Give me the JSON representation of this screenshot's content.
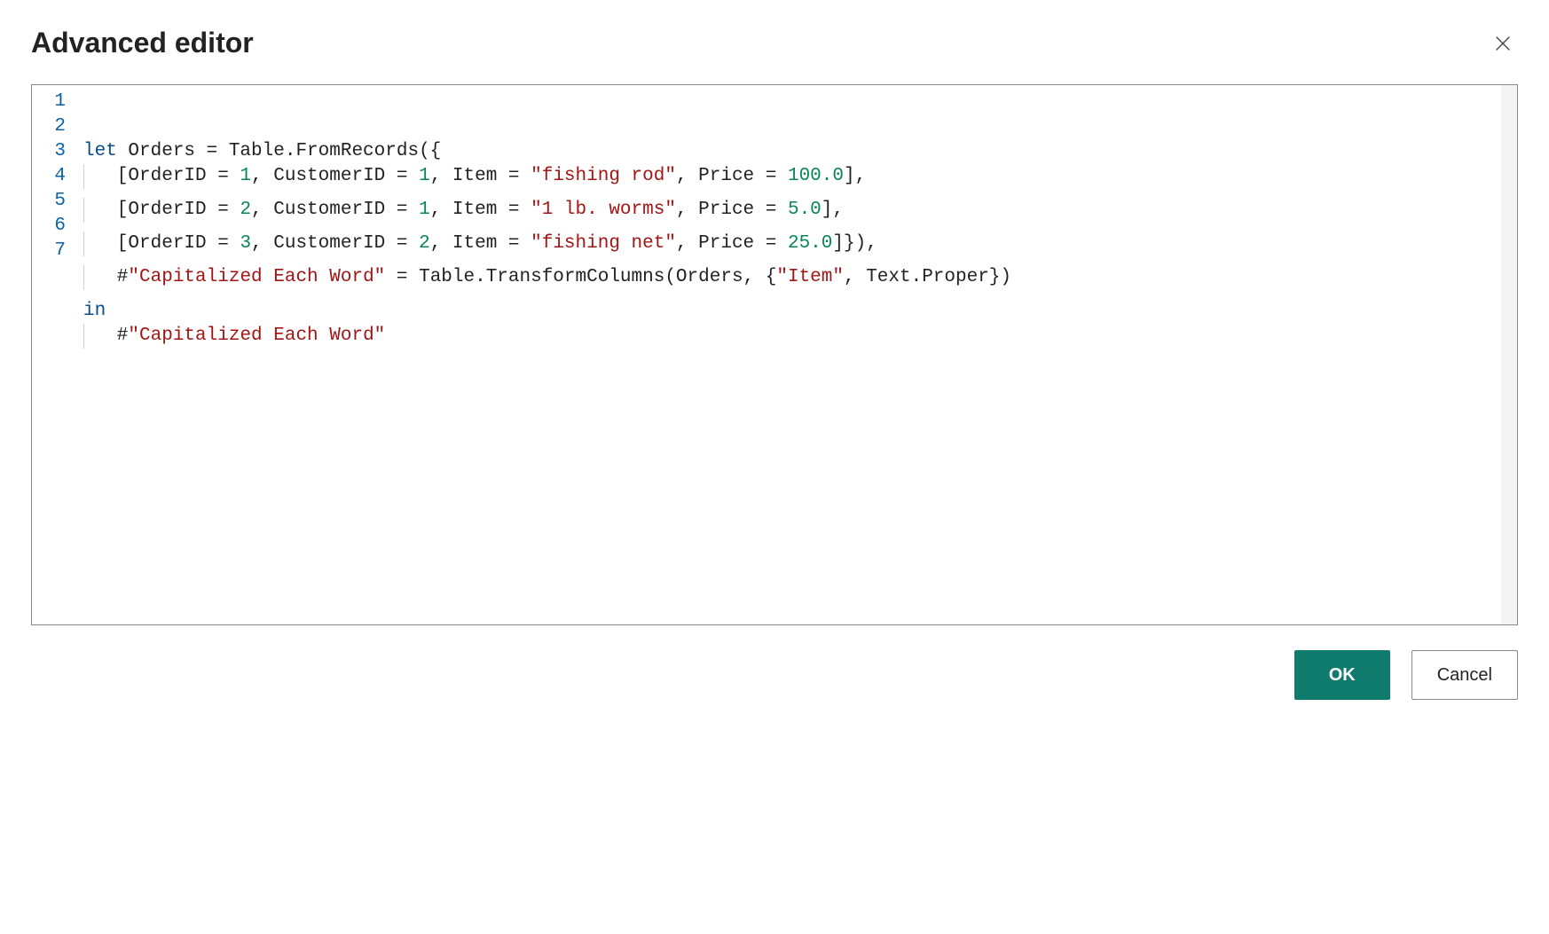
{
  "header": {
    "title": "Advanced editor"
  },
  "editor": {
    "line_numbers": [
      "1",
      "2",
      "3",
      "4",
      "5",
      "6",
      "7"
    ],
    "lines": [
      {
        "indent": 0,
        "tokens": [
          {
            "t": "kw",
            "v": "let"
          },
          {
            "t": "ident",
            "v": " Orders = Table.FromRecords({"
          }
        ]
      },
      {
        "indent": 1,
        "tokens": [
          {
            "t": "ident",
            "v": "   [OrderID = "
          },
          {
            "t": "num",
            "v": "1"
          },
          {
            "t": "ident",
            "v": ", CustomerID = "
          },
          {
            "t": "num",
            "v": "1"
          },
          {
            "t": "ident",
            "v": ", Item = "
          },
          {
            "t": "str",
            "v": "\"fishing rod\""
          },
          {
            "t": "ident",
            "v": ", Price = "
          },
          {
            "t": "num",
            "v": "100.0"
          },
          {
            "t": "ident",
            "v": "],"
          }
        ]
      },
      {
        "indent": 1,
        "tokens": [
          {
            "t": "ident",
            "v": "   [OrderID = "
          },
          {
            "t": "num",
            "v": "2"
          },
          {
            "t": "ident",
            "v": ", CustomerID = "
          },
          {
            "t": "num",
            "v": "1"
          },
          {
            "t": "ident",
            "v": ", Item = "
          },
          {
            "t": "str",
            "v": "\"1 lb. worms\""
          },
          {
            "t": "ident",
            "v": ", Price = "
          },
          {
            "t": "num",
            "v": "5.0"
          },
          {
            "t": "ident",
            "v": "],"
          }
        ]
      },
      {
        "indent": 1,
        "tokens": [
          {
            "t": "ident",
            "v": "   [OrderID = "
          },
          {
            "t": "num",
            "v": "3"
          },
          {
            "t": "ident",
            "v": ", CustomerID = "
          },
          {
            "t": "num",
            "v": "2"
          },
          {
            "t": "ident",
            "v": ", Item = "
          },
          {
            "t": "str",
            "v": "\"fishing net\""
          },
          {
            "t": "ident",
            "v": ", Price = "
          },
          {
            "t": "num",
            "v": "25.0"
          },
          {
            "t": "ident",
            "v": "]}),"
          }
        ]
      },
      {
        "indent": 1,
        "tokens": [
          {
            "t": "ident",
            "v": "   #"
          },
          {
            "t": "str",
            "v": "\"Capitalized Each Word\""
          },
          {
            "t": "ident",
            "v": " = Table.TransformColumns(Orders, {"
          },
          {
            "t": "str",
            "v": "\"Item\""
          },
          {
            "t": "ident",
            "v": ", Text.Proper})"
          }
        ]
      },
      {
        "indent": 0,
        "tokens": [
          {
            "t": "kw",
            "v": "in"
          }
        ]
      },
      {
        "indent": 1,
        "tokens": [
          {
            "t": "ident",
            "v": "   #"
          },
          {
            "t": "str",
            "v": "\"Capitalized Each Word\""
          }
        ]
      }
    ]
  },
  "buttons": {
    "ok": "OK",
    "cancel": "Cancel"
  }
}
